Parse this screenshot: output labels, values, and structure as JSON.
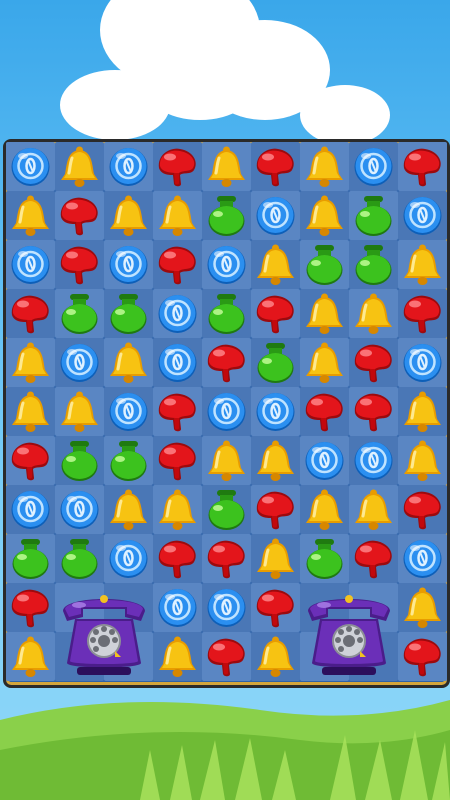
{
  "game": {
    "board": {
      "columns": 9,
      "rows": 11,
      "grid": [
        [
          "coin",
          "bell",
          "coin",
          "mushroom",
          "bell",
          "mushroom",
          "bell",
          "coin",
          "mushroom"
        ],
        [
          "bell",
          "mushroom",
          "bell",
          "bell",
          "potion",
          "coin",
          "bell",
          "potion",
          "coin"
        ],
        [
          "coin",
          "mushroom",
          "coin",
          "mushroom",
          "coin",
          "bell",
          "potion",
          "potion",
          "bell"
        ],
        [
          "mushroom",
          "potion",
          "potion",
          "coin",
          "potion",
          "mushroom",
          "bell",
          "bell",
          "mushroom"
        ],
        [
          "bell",
          "coin",
          "bell",
          "coin",
          "mushroom",
          "potion",
          "bell",
          "mushroom",
          "coin"
        ],
        [
          "bell",
          "bell",
          "coin",
          "mushroom",
          "coin",
          "coin",
          "mushroom",
          "mushroom",
          "bell"
        ],
        [
          "mushroom",
          "potion",
          "potion",
          "mushroom",
          "bell",
          "bell",
          "coin",
          "coin",
          "bell"
        ],
        [
          "coin",
          "coin",
          "bell",
          "bell",
          "potion",
          "mushroom",
          "bell",
          "bell",
          "mushroom"
        ],
        [
          "potion",
          "potion",
          "coin",
          "mushroom",
          "mushroom",
          "bell",
          "potion",
          "mushroom",
          "coin"
        ],
        [
          "mushroom",
          "telephone",
          "telephone",
          "coin",
          "coin",
          "mushroom",
          "telephone",
          "telephone",
          "bell"
        ],
        [
          "bell",
          "telephone",
          "telephone",
          "bell",
          "mushroom",
          "bell",
          "telephone",
          "telephone",
          "mushroom"
        ]
      ],
      "special_pieces": [
        {
          "type": "telephone",
          "row": 9,
          "col": 1,
          "span": 2
        },
        {
          "type": "telephone",
          "row": 9,
          "col": 6,
          "span": 2
        }
      ]
    },
    "colors": {
      "coin": "#2b8ff0",
      "bell": "#f7c312",
      "mushroom": "#e3151b",
      "potion": "#3cc21e",
      "telephone": "#6b2fb8",
      "board_frame": "#d4a63c",
      "sky": "#5bbcf3",
      "grass": "#7cc43a"
    },
    "icons": {
      "coin": "blue-coin-icon",
      "bell": "yellow-bell-icon",
      "mushroom": "red-mushroom-icon",
      "potion": "green-potion-icon",
      "telephone": "purple-telephone-icon"
    }
  }
}
